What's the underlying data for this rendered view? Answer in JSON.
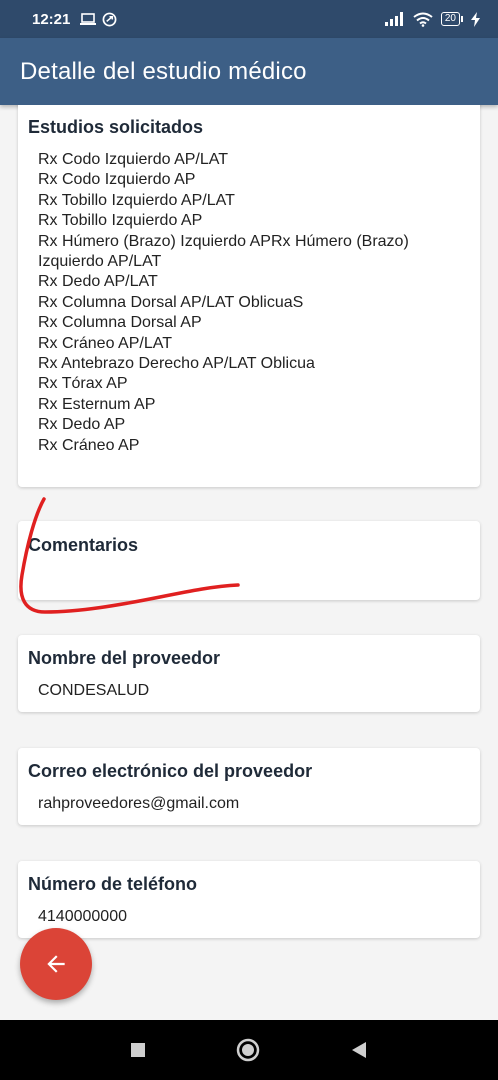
{
  "status_bar": {
    "time": "12:21",
    "battery": "20"
  },
  "app_bar": {
    "title": "Detalle del estudio médico"
  },
  "studies_card": {
    "title": "Estudios solicitados",
    "items": [
      "Rx Codo Izquierdo AP/LAT",
      "Rx Codo Izquierdo AP",
      "Rx Tobillo Izquierdo AP/LAT",
      "Rx Tobillo Izquierdo AP",
      "Rx Húmero (Brazo) Izquierdo APRx Húmero (Brazo)",
      "Izquierdo AP/LAT",
      "Rx Dedo AP/LAT",
      "Rx Columna Dorsal AP/LAT OblicuaS",
      "Rx Columna Dorsal AP",
      "Rx Cráneo AP/LAT",
      "Rx Antebrazo Derecho AP/LAT Oblicua",
      "Rx Tórax AP",
      "Rx Esternum AP",
      "Rx Dedo AP",
      "Rx Cráneo AP"
    ]
  },
  "comments_card": {
    "title": "Comentarios",
    "value": ""
  },
  "provider_card": {
    "title": "Nombre del proveedor",
    "value": "CONDESALUD"
  },
  "email_card": {
    "title": "Correo electrónico del proveedor",
    "value": "rahproveedores@gmail.com"
  },
  "phone_card": {
    "title": "Número de teléfono",
    "value": "4140000000"
  },
  "fab": {
    "icon": "arrow-back-icon"
  },
  "nav_bar": {
    "icons": [
      "recent-apps-icon",
      "home-icon",
      "back-icon"
    ]
  },
  "colors": {
    "app_bar": "#3d5f86",
    "status_bar": "#2f4a6b",
    "fab": "#db4437",
    "annotation": "#e02020"
  }
}
